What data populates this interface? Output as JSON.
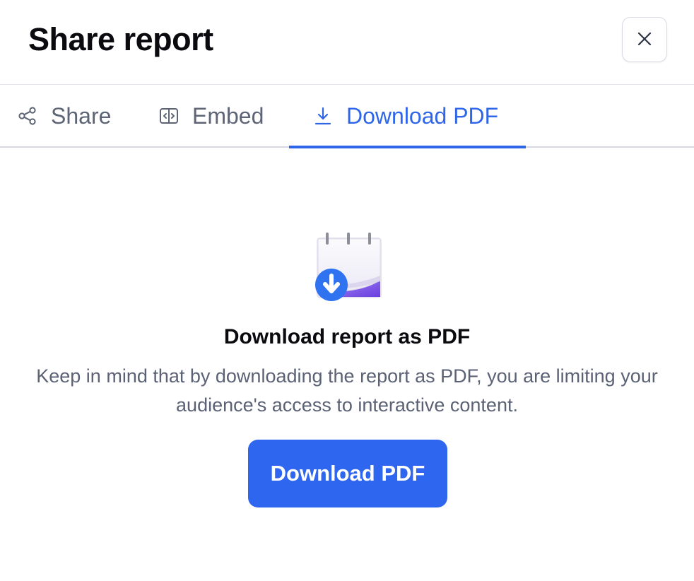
{
  "header": {
    "title": "Share report",
    "close_icon": "close-icon"
  },
  "tabs": [
    {
      "label": "Share",
      "icon": "share-icon",
      "active": false
    },
    {
      "label": "Embed",
      "icon": "embed-icon",
      "active": false
    },
    {
      "label": "Download PDF",
      "icon": "download-icon",
      "active": true
    }
  ],
  "download_panel": {
    "illustration_icon": "notepad-download-icon",
    "heading": "Download report as PDF",
    "description": "Keep in mind that by downloading the report as PDF, you are limiting your audience's access to interactive content.",
    "button_label": "Download PDF"
  },
  "colors": {
    "accent": "#2f66f0",
    "active_tab": "#2f66e8",
    "muted_text": "#5d6475",
    "title_text": "#0b0b0f",
    "divider": "#e3e5ea"
  }
}
